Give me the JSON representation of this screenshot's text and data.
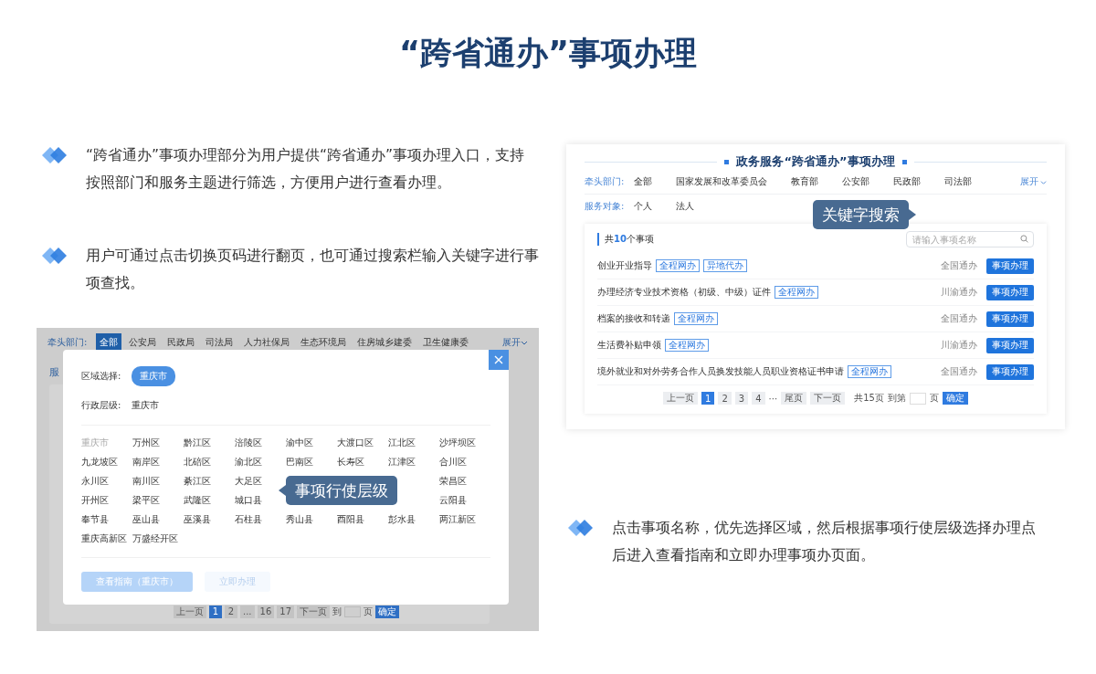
{
  "title": "“跨省通办”事项办理",
  "notes": [
    {
      "text": "“跨省通办”事项办理部分为用户提供“跨省通办”事项办理入口，支持按照部门和服务主题进行筛选，方便用户进行查看办理。"
    },
    {
      "text": "用户可通过点击切换页码进行翻页，也可通过搜索栏输入关键字进行事项查找。"
    },
    {
      "text": "点击事项名称，优先选择区域，然后根据事项行使层级选择办理点后进入查看指南和立即办理事项办页面。"
    }
  ],
  "region_demo": {
    "departments_label": "牵头部门:",
    "departments": [
      {
        "label": "全部",
        "selected": true
      },
      {
        "label": "公安局",
        "selected": false
      },
      {
        "label": "民政局",
        "selected": false
      },
      {
        "label": "司法局",
        "selected": false
      },
      {
        "label": "人力社保局",
        "selected": false
      },
      {
        "label": "生态环境局",
        "selected": false
      },
      {
        "label": "住房城乡建委",
        "selected": false
      },
      {
        "label": "卫生健康委",
        "selected": false
      }
    ],
    "expand": "展开",
    "service_label": "服",
    "modal": {
      "region_label": "区域选择:",
      "region": "重庆市",
      "level_label": "行政层级:",
      "level": "重庆市",
      "districts": [
        {
          "label": "重庆市",
          "disabled": true
        },
        {
          "label": "万州区",
          "disabled": false
        },
        {
          "label": "黔江区",
          "disabled": false
        },
        {
          "label": "涪陵区",
          "disabled": false
        },
        {
          "label": "渝中区",
          "disabled": false
        },
        {
          "label": "大渡口区",
          "disabled": false
        },
        {
          "label": "江北区",
          "disabled": false
        },
        {
          "label": "沙坪坝区",
          "disabled": false
        },
        {
          "label": "九龙坡区",
          "disabled": false
        },
        {
          "label": "南岸区",
          "disabled": false
        },
        {
          "label": "北碚区",
          "disabled": false
        },
        {
          "label": "渝北区",
          "disabled": false
        },
        {
          "label": "巴南区",
          "disabled": false
        },
        {
          "label": "长寿区",
          "disabled": false
        },
        {
          "label": "江津区",
          "disabled": false
        },
        {
          "label": "合川区",
          "disabled": false
        },
        {
          "label": "永川区",
          "disabled": false
        },
        {
          "label": "南川区",
          "disabled": false
        },
        {
          "label": "綦江区",
          "disabled": false
        },
        {
          "label": "大足区",
          "disabled": false
        },
        {
          "label": "荣昌区",
          "disabled": false
        },
        {
          "label": "开州区",
          "disabled": false
        },
        {
          "label": "梁平区",
          "disabled": false
        },
        {
          "label": "武隆区",
          "disabled": false
        },
        {
          "label": "城口县",
          "disabled": false
        },
        {
          "label": "云阳县",
          "disabled": false
        },
        {
          "label": "奉节县",
          "disabled": false
        },
        {
          "label": "巫山县",
          "disabled": false
        },
        {
          "label": "巫溪县",
          "disabled": false
        },
        {
          "label": "石柱县",
          "disabled": false
        },
        {
          "label": "秀山县",
          "disabled": false
        },
        {
          "label": "酉阳县",
          "disabled": false
        },
        {
          "label": "彭水县",
          "disabled": false
        },
        {
          "label": "两江新区",
          "disabled": false
        },
        {
          "label": "重庆高新区",
          "disabled": false
        },
        {
          "label": "万盛经开区",
          "disabled": false
        }
      ],
      "buttons": [
        {
          "label": "查看指南（重庆市）",
          "kind": "primary",
          "disabled": true
        },
        {
          "label": "立即办理",
          "kind": "secondary",
          "disabled": true
        }
      ]
    },
    "pagination": {
      "prev": "上一页",
      "pages": [
        {
          "label": "1",
          "selected": true
        },
        {
          "label": "2",
          "selected": false
        },
        {
          "label": "...",
          "selected": false
        },
        {
          "label": "16",
          "selected": false
        },
        {
          "label": "17",
          "selected": false
        }
      ],
      "next": "下一页",
      "goto": "到",
      "page_unit": "页",
      "confirm": "确定"
    },
    "callout": "事项行使层级"
  },
  "search_demo": {
    "heading": "政务服务“跨省通办”事项办理",
    "filters": [
      {
        "label": "牵头部门:",
        "options": [
          "全部",
          "国家发展和改革委员会",
          "教育部",
          "公安部",
          "民政部",
          "司法部"
        ]
      },
      {
        "label": "服务对象:",
        "options": [
          "个人",
          "法人"
        ]
      }
    ],
    "expand": "展开",
    "callout": "关键字搜索",
    "count": "共**10**个事项",
    "search": {
      "placeholder": "请输入事项名称"
    },
    "items": [
      {
        "name": "创业开业指导",
        "tags": [
          "全程网办",
          "异地代办"
        ],
        "scope": "全国通办",
        "action": "事项办理"
      },
      {
        "name": "办理经济专业技术资格（初级、中级）证件",
        "tags": [
          "全程网办"
        ],
        "scope": "川渝通办",
        "action": "事项办理"
      },
      {
        "name": "档案的接收和转递",
        "tags": [
          "全程网办"
        ],
        "scope": "全国通办",
        "action": "事项办理"
      },
      {
        "name": "生活费补贴申领",
        "tags": [
          "全程网办"
        ],
        "scope": "川渝通办",
        "action": "事项办理"
      },
      {
        "name": "境外就业和对外劳务合作人员换发技能人员职业资格证书申请",
        "tags": [
          "全程网办"
        ],
        "scope": "全国通办",
        "action": "事项办理"
      }
    ],
    "pagination": {
      "prev": "上一页",
      "pages": [
        {
          "label": "1",
          "selected": true
        },
        {
          "label": "2",
          "selected": false
        },
        {
          "label": "3",
          "selected": false
        },
        {
          "label": "4",
          "selected": false
        }
      ],
      "ellipsis": "···",
      "last": "尾页",
      "next": "下一页",
      "total": "共15页",
      "goto": "到第",
      "page_unit": "页",
      "confirm": "确定"
    }
  }
}
